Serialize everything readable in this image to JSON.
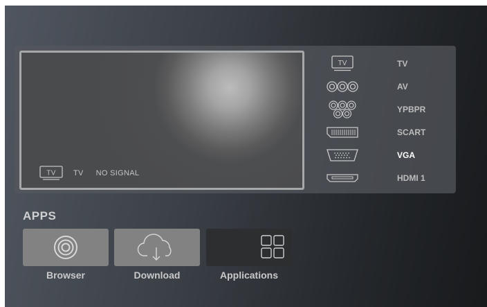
{
  "preview": {
    "icon_text": "TV",
    "source_label": "TV",
    "status": "NO SIGNAL"
  },
  "sources": [
    {
      "label": "TV",
      "icon": "tv-icon",
      "active": false
    },
    {
      "label": "AV",
      "icon": "av-rca-icon",
      "active": false
    },
    {
      "label": "YPBPR",
      "icon": "ypbpr-component-icon",
      "active": false
    },
    {
      "label": "SCART",
      "icon": "scart-connector-icon",
      "active": false
    },
    {
      "label": "VGA",
      "icon": "vga-connector-icon",
      "active": true
    },
    {
      "label": "HDMI 1",
      "icon": "hdmi-connector-icon",
      "active": false
    }
  ],
  "apps": {
    "title": "APPS",
    "items": [
      {
        "label": "Browser",
        "icon": "browser-icon"
      },
      {
        "label": "Download",
        "icon": "cloud-download-icon"
      },
      {
        "label": "Applications",
        "icon": "app-grid-icon"
      }
    ]
  },
  "colors": {
    "active_source_text": "#ffffff",
    "inactive_source_text": "#bdbdbd",
    "selected_app_bg": "#2d2e30",
    "app_tile_bg": "#828283"
  }
}
